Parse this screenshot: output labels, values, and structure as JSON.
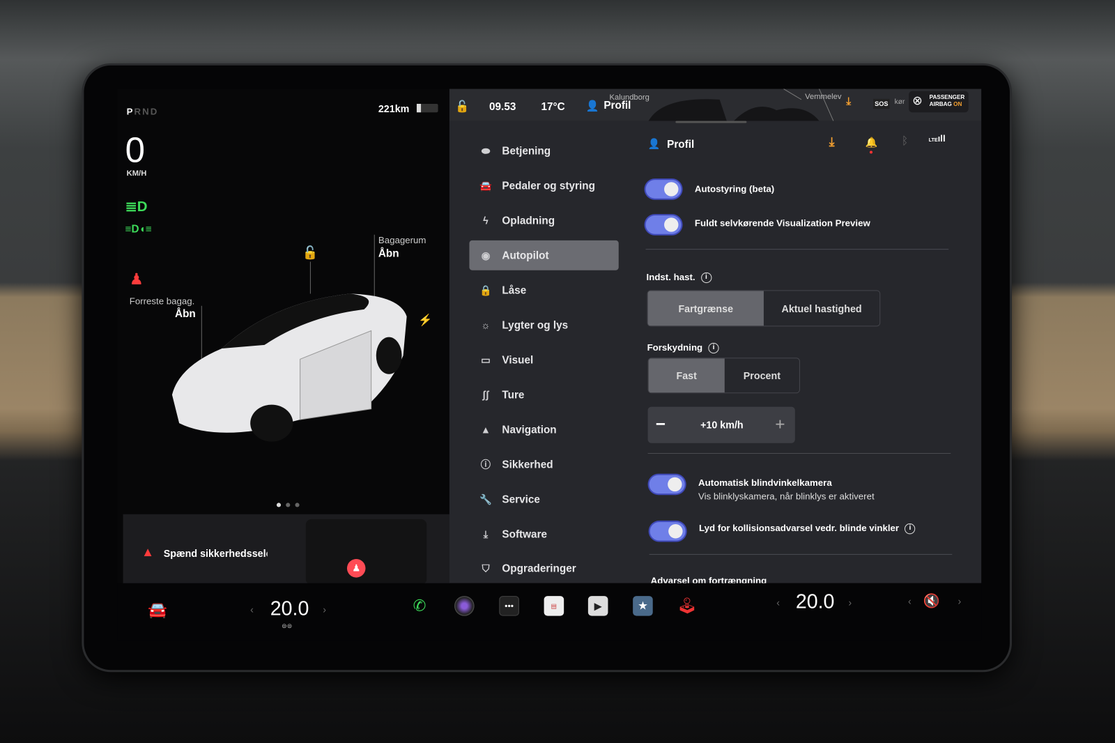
{
  "left_panel": {
    "gear": {
      "selected": "P",
      "others": "RND"
    },
    "speed": "0",
    "speed_unit": "KM/H",
    "range": "221km",
    "battery_level_percent": 20,
    "frunk": {
      "label": "Forreste bagag.",
      "action": "Åbn"
    },
    "trunk": {
      "label": "Bagagerum",
      "action": "Åbn"
    },
    "alert": "Spænd sikkerhedssele",
    "indicator_colors": {
      "lights": "#3ddc5a",
      "seatbelt": "#ff3b3b"
    }
  },
  "topbar": {
    "time": "09.53",
    "temperature": "17°C",
    "profile": "Profil",
    "map_labels": [
      "Kalundborg",
      "Vemmelev"
    ],
    "sos": "SOS",
    "map_label_partial": "kør",
    "airbag": {
      "line1": "PASSENGER",
      "line2": "AIRBAG",
      "state": "ON"
    }
  },
  "menu": [
    {
      "label": "Betjening",
      "icon": "toggle-icon"
    },
    {
      "label": "Pedaler og styring",
      "icon": "car-icon"
    },
    {
      "label": "Opladning",
      "icon": "bolt-icon"
    },
    {
      "label": "Autopilot",
      "icon": "steering-wheel-icon",
      "active": true
    },
    {
      "label": "Låse",
      "icon": "lock-icon"
    },
    {
      "label": "Lygter og lys",
      "icon": "sun-icon"
    },
    {
      "label": "Visuel",
      "icon": "display-icon"
    },
    {
      "label": "Ture",
      "icon": "trips-icon"
    },
    {
      "label": "Navigation",
      "icon": "navigation-icon"
    },
    {
      "label": "Sikkerhed",
      "icon": "alert-circle-icon"
    },
    {
      "label": "Service",
      "icon": "wrench-icon"
    },
    {
      "label": "Software",
      "icon": "download-icon"
    },
    {
      "label": "Opgraderinger",
      "icon": "bag-icon"
    }
  ],
  "content": {
    "profile": "Profil",
    "toggles": [
      {
        "label": "Autostyring (beta)",
        "on": true
      },
      {
        "label": "Fuldt selvkørende Visualization Preview",
        "on": true
      }
    ],
    "set_speed": {
      "label": "Indst. hast.",
      "options": [
        "Fartgrænse",
        "Aktuel hastighed"
      ],
      "selected": "Fartgrænse"
    },
    "offset": {
      "label": "Forskydning",
      "options": [
        "Fast",
        "Procent"
      ],
      "selected": "Fast",
      "value": "+10 km/h"
    },
    "blind_spot_camera": {
      "label": "Automatisk blindvinkelkamera",
      "sub": "Vis blinklyskamera, når blinklys er aktiveret",
      "on": true
    },
    "blind_spot_chime": {
      "label": "Lyd for kollisionsadvarsel vedr. blinde vinkler",
      "on": true
    },
    "cut_off": "Advarsel om fortrængning"
  },
  "dock": {
    "driver_temp": "20.0",
    "passenger_temp": "20.0",
    "accent": "#6f7fe8"
  }
}
